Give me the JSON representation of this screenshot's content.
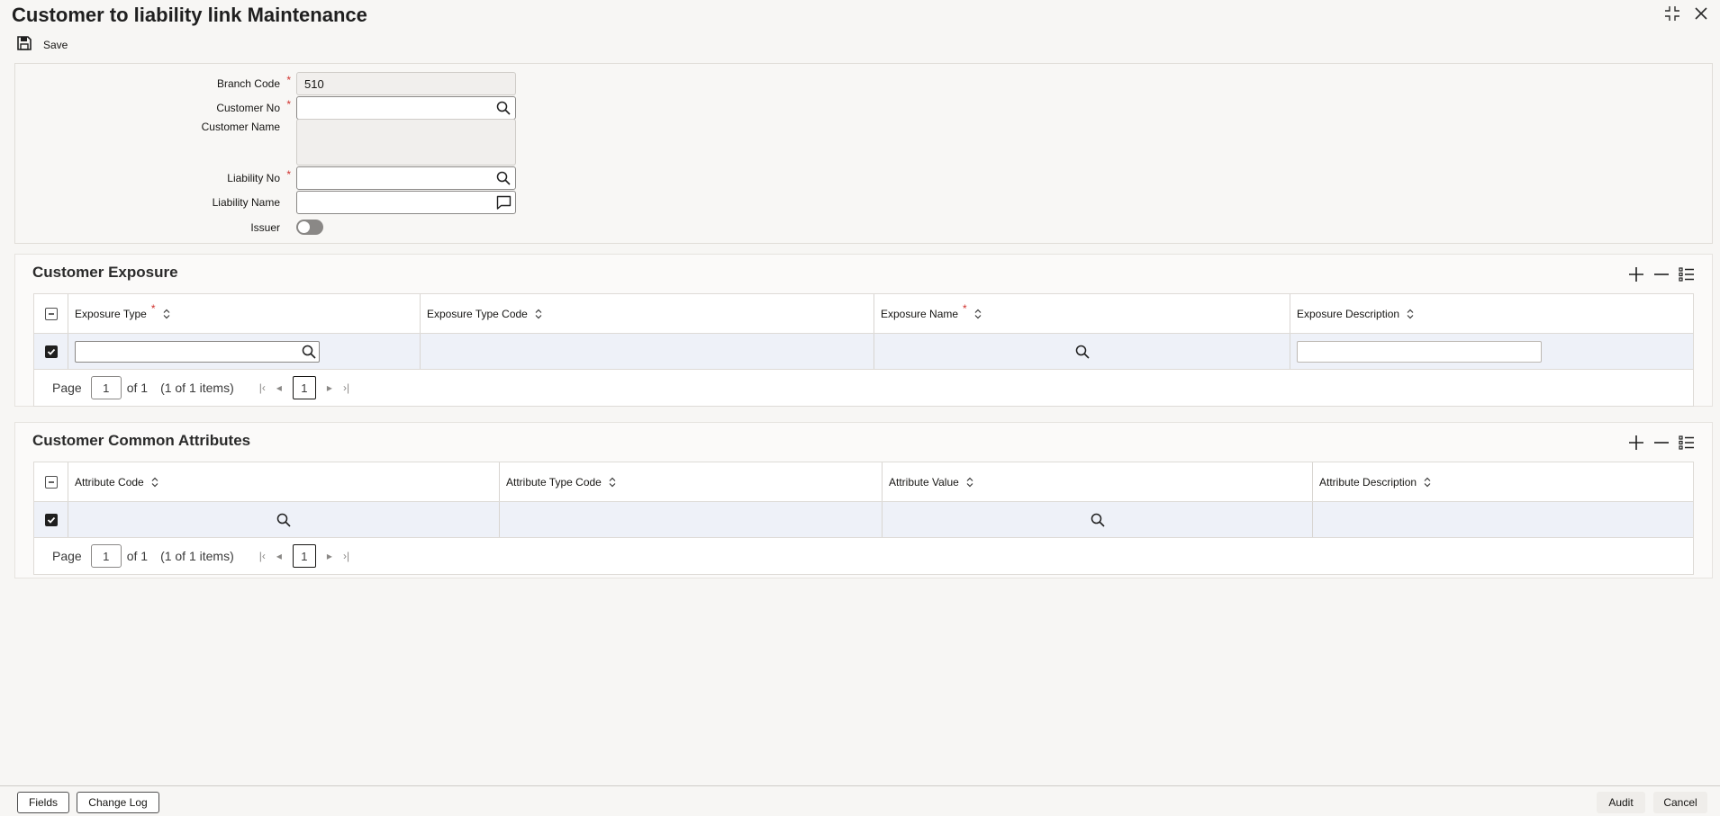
{
  "window": {
    "title": "Customer to liability link Maintenance",
    "controls": [
      "collapse-icon",
      "close-icon"
    ]
  },
  "toolbar": {
    "save_label": "Save",
    "save_icon": "save-icon"
  },
  "form": {
    "branch_code": {
      "label": "Branch Code",
      "value": "510",
      "required": true
    },
    "customer_no": {
      "label": "Customer No",
      "value": "",
      "required": true,
      "icon": "search-icon"
    },
    "customer_name": {
      "label": "Customer Name",
      "value": ""
    },
    "liability_no": {
      "label": "Liability No",
      "value": "",
      "required": true,
      "icon": "search-icon"
    },
    "liability_name": {
      "label": "Liability Name",
      "value": "",
      "icon": "comment-icon"
    },
    "issuer": {
      "label": "Issuer",
      "checked": false
    }
  },
  "required_mark": "*",
  "exposure": {
    "title": "Customer Exposure",
    "columns": [
      {
        "label": "Exposure Type",
        "required": true
      },
      {
        "label": "Exposure Type Code",
        "required": false
      },
      {
        "label": "Exposure Name",
        "required": true
      },
      {
        "label": "Exposure Description",
        "required": false
      }
    ],
    "rows": [
      {
        "exposure_type": "",
        "exposure_type_code": "",
        "exposure_name": "",
        "exposure_description": "",
        "selected": true
      }
    ],
    "pager": {
      "page_label": "Page",
      "page": "1",
      "of_label": "of 1",
      "items_label": "(1 of 1 items)",
      "current": "1"
    }
  },
  "attributes": {
    "title": "Customer Common Attributes",
    "columns": [
      {
        "label": "Attribute Code"
      },
      {
        "label": "Attribute Type Code"
      },
      {
        "label": "Attribute Value"
      },
      {
        "label": "Attribute Description"
      }
    ],
    "rows": [
      {
        "attribute_code": "",
        "attribute_type_code": "",
        "attribute_value": "",
        "attribute_description": "",
        "selected": true
      }
    ],
    "pager": {
      "page_label": "Page",
      "page": "1",
      "of_label": "of 1",
      "items_label": "(1 of 1 items)",
      "current": "1"
    }
  },
  "footer": {
    "fields_label": "Fields",
    "change_log_label": "Change Log",
    "audit_label": "Audit",
    "cancel_label": "Cancel"
  },
  "colors": {
    "required": "#d0312d",
    "row_highlight": "#eef1f8",
    "background": "#f7f6f4"
  }
}
